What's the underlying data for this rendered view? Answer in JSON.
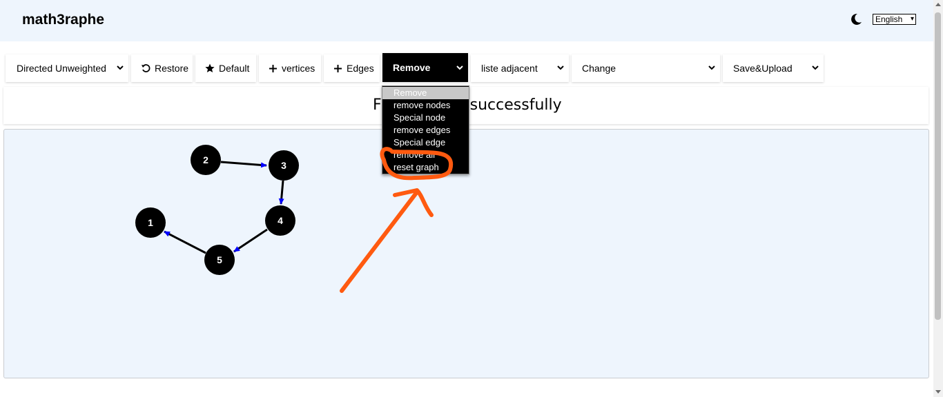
{
  "header": {
    "brand": "math3raphe",
    "theme_icon": "moon-icon",
    "language": "English"
  },
  "toolbar": {
    "graph_type": "Directed Unweighted",
    "restore": "Restore",
    "default": "Default",
    "vertices": "vertices",
    "edges": "Edges",
    "remove": "Remove",
    "adjacent": "liste adjacent",
    "change": "Change",
    "save_upload": "Save&Upload"
  },
  "remove_menu": {
    "items": [
      "Remove",
      "remove nodes",
      "Special node",
      "remove edges",
      "Special edge",
      "remove all",
      "reset graph"
    ],
    "selected": "Remove"
  },
  "status": {
    "message_visible_prefix": "F",
    "message_visible_suffix": "successfully"
  },
  "graph": {
    "nodes": [
      "1",
      "2",
      "3",
      "4",
      "5"
    ],
    "edges": [
      {
        "from": "2",
        "to": "3"
      },
      {
        "from": "3",
        "to": "4"
      },
      {
        "from": "4",
        "to": "5"
      },
      {
        "from": "5",
        "to": "1"
      }
    ],
    "node_color": "#000000",
    "edge_color": "#000000",
    "arrow_color": "#0000ff"
  },
  "annotation": {
    "color": "#ff5a10"
  },
  "colors": {
    "header_bg": "#eef5fd",
    "canvas_bg": "#eef5fd",
    "active_button_bg": "#000000"
  }
}
